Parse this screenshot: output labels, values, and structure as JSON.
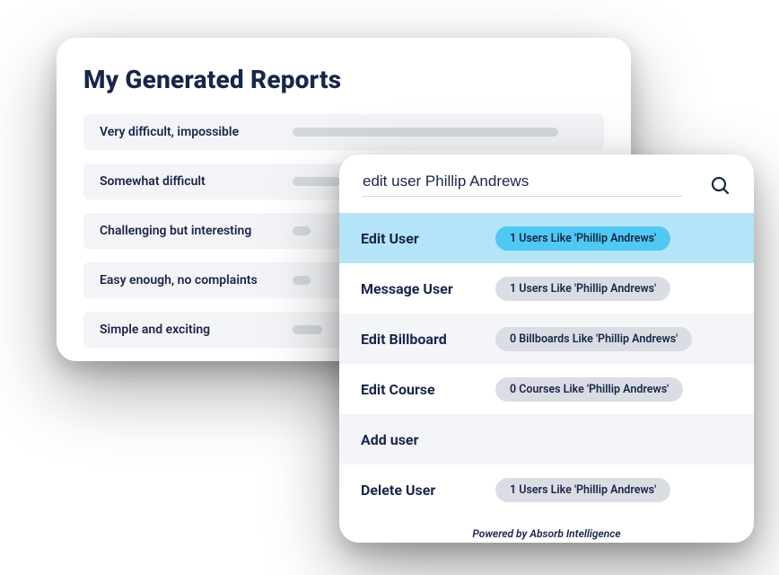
{
  "reports": {
    "title": "My Generated Reports",
    "items": [
      {
        "label": "Very difficult, impossible",
        "bar": 90
      },
      {
        "label": "Somewhat difficult",
        "bar": 16
      },
      {
        "label": "Challenging but interesting",
        "bar": 6
      },
      {
        "label": "Easy enough, no complaints",
        "bar": 6
      },
      {
        "label": "Simple and exciting",
        "bar": 10
      }
    ]
  },
  "search": {
    "query": "edit user Phillip Andrews",
    "powered": "Powered by Absorb Intelligence",
    "actions": [
      {
        "label": "Edit User",
        "badge": "1 Users Like 'Phillip Andrews'",
        "selected": true
      },
      {
        "label": "Message User",
        "badge": "1 Users Like 'Phillip Andrews'",
        "selected": false
      },
      {
        "label": "Edit Billboard",
        "badge": "0 Billboards Like 'Phillip Andrews'",
        "selected": false
      },
      {
        "label": "Edit Course",
        "badge": "0 Courses Like 'Phillip Andrews'",
        "selected": false
      },
      {
        "label": "Add user",
        "badge": null,
        "selected": false
      },
      {
        "label": "Delete User",
        "badge": "1 Users Like 'Phillip Andrews'",
        "selected": false
      }
    ]
  }
}
